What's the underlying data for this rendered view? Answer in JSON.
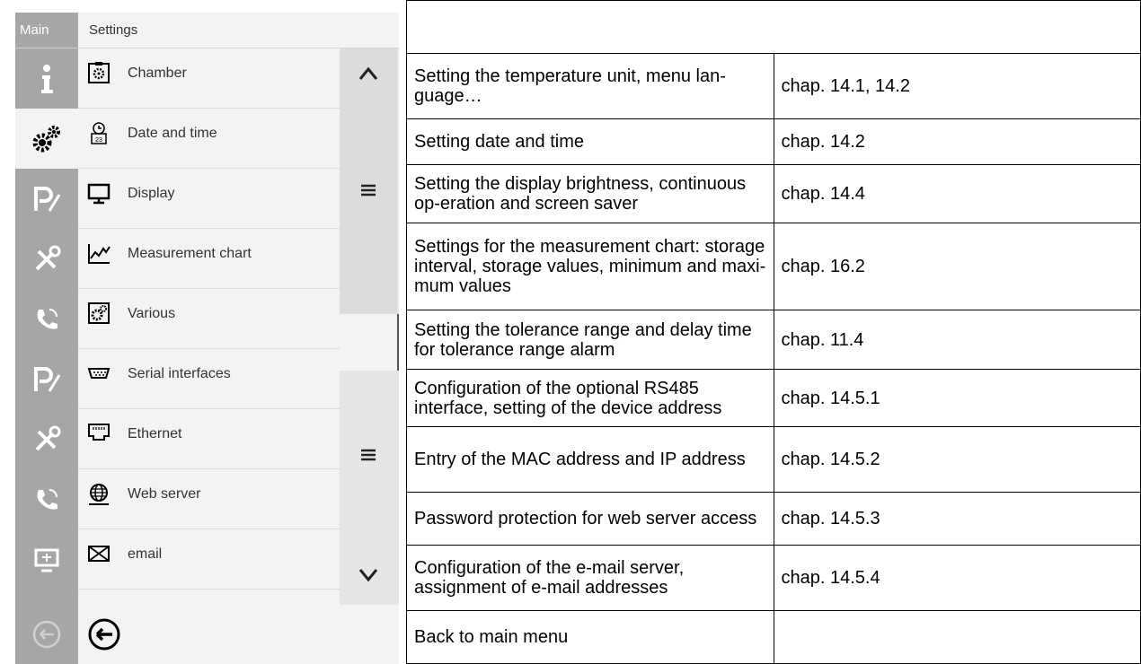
{
  "device": {
    "main_tab": "Main",
    "settings_title": "Settings",
    "rail_icons": [
      "info-icon",
      "gears-icon",
      "program-icon",
      "tools-icon",
      "phone-icon",
      "program-icon",
      "tools-icon",
      "phone-icon",
      "display-icon",
      "back-icon"
    ],
    "menu_items": [
      {
        "label": "Chamber",
        "icon": "chamber-icon"
      },
      {
        "label": "Date and time",
        "icon": "calendar-clock-icon"
      },
      {
        "label": "Display",
        "icon": "monitor-icon"
      },
      {
        "label": "Measurement chart",
        "icon": "chart-icon"
      },
      {
        "label": "Various",
        "icon": "gear-box-icon"
      },
      {
        "label": "Serial interfaces",
        "icon": "serial-port-icon"
      },
      {
        "label": "Ethernet",
        "icon": "ethernet-icon"
      },
      {
        "label": "Web server",
        "icon": "globe-icon"
      },
      {
        "label": "email",
        "icon": "envelope-icon"
      }
    ],
    "scroll": {
      "up": "^",
      "handle": "≡",
      "down": "v"
    }
  },
  "table": {
    "rows": [
      {
        "desc": "",
        "chap": ""
      },
      {
        "desc": "Setting the temperature unit, menu lan-guage…",
        "chap": "chap. 14.1, 14.2"
      },
      {
        "desc": "Setting date and time",
        "chap": "chap. 14.2"
      },
      {
        "desc": "Setting the display brightness, continuous op-eration and screen saver",
        "chap": "chap. 14.4"
      },
      {
        "desc": "Settings for the measurement chart: storage interval, storage values, minimum and maxi-mum values",
        "chap": "chap. 16.2"
      },
      {
        "desc": "Setting the tolerance range and delay time for tolerance range alarm",
        "chap": "chap. 11.4"
      },
      {
        "desc": "Configuration of the optional RS485 interface, setting of the device address",
        "chap": "chap. 14.5.1"
      },
      {
        "desc": "Entry of the MAC address and IP address",
        "chap": "chap. 14.5.2"
      },
      {
        "desc": "Password protection for web server access",
        "chap": "chap. 14.5.3"
      },
      {
        "desc": "Configuration of the e-mail server, assignment of e-mail addresses",
        "chap": "chap. 14.5.4"
      },
      {
        "desc": "Back to main menu",
        "chap": ""
      }
    ]
  }
}
